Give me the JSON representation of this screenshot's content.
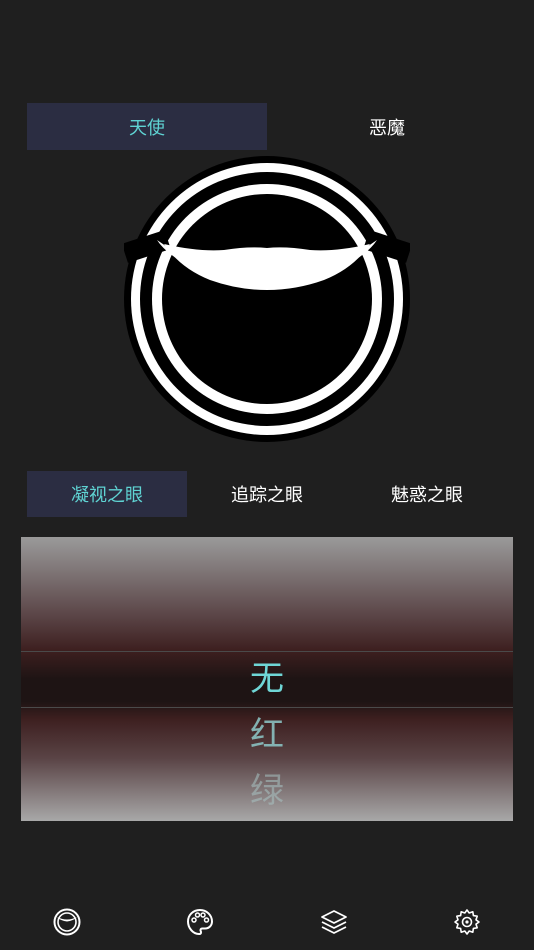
{
  "mode_tabs": [
    {
      "label": "天使",
      "active": true
    },
    {
      "label": "恶魔",
      "active": false
    }
  ],
  "eye_tabs": [
    {
      "label": "凝视之眼",
      "active": true
    },
    {
      "label": "追踪之眼",
      "active": false
    },
    {
      "label": "魅惑之眼",
      "active": false
    }
  ],
  "color_picker": {
    "selected": "无",
    "items": [
      "无",
      "红",
      "绿"
    ]
  },
  "bottom_nav": [
    {
      "icon": "eye-emblem-icon"
    },
    {
      "icon": "palette-icon"
    },
    {
      "icon": "layers-icon"
    },
    {
      "icon": "gear-icon"
    }
  ],
  "colors": {
    "background": "#1f1f1f",
    "accent": "#5fd3d3",
    "tab_active_bg": "#2b2d42"
  }
}
